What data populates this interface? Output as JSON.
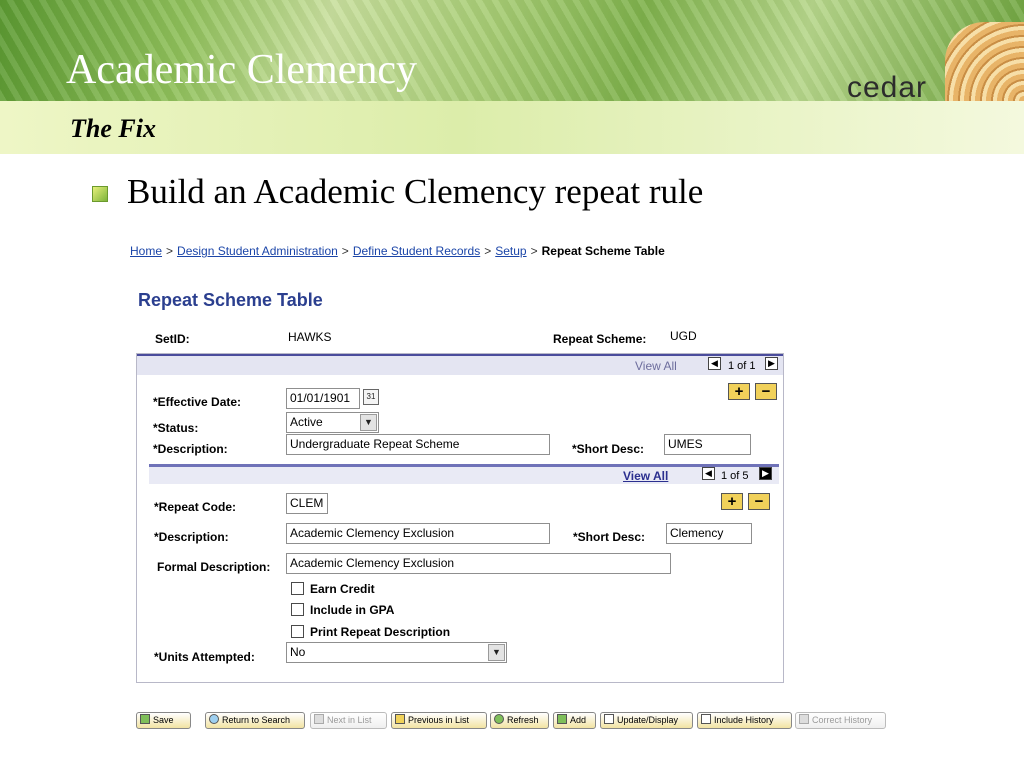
{
  "slide": {
    "title": "Academic Clemency",
    "subtitle": "The Fix",
    "logo_text": "cedar",
    "bullet": "Build an Academic Clemency repeat rule"
  },
  "breadcrumb": {
    "items": [
      "Home",
      "Design Student Administration",
      "Define Student Records",
      "Setup"
    ],
    "current": "Repeat Scheme Table",
    "sep": ">"
  },
  "page": {
    "title": "Repeat Scheme Table",
    "setid_label": "SetID:",
    "setid_value": "HAWKS",
    "scheme_label": "Repeat Scheme:",
    "scheme_value": "UGD"
  },
  "outer_grid": {
    "view_all": "View All",
    "pager": "1 of 1",
    "effective_date_label": "*Effective Date:",
    "effective_date": "01/01/1901",
    "status_label": "*Status:",
    "status": "Active",
    "description_label": "*Description:",
    "description": "Undergraduate Repeat Scheme",
    "short_desc_label": "*Short Desc:",
    "short_desc": "UMES"
  },
  "inner_grid": {
    "view_all": "View All",
    "pager": "1 of 5",
    "repeat_code_label": "*Repeat Code:",
    "repeat_code": "CLEM",
    "description_label": "*Description:",
    "description": "Academic Clemency Exclusion",
    "short_desc_label": "*Short Desc:",
    "short_desc": "Clemency",
    "formal_desc_label": "Formal Description:",
    "formal_desc": "Academic Clemency Exclusion",
    "checkboxes": [
      "Earn Credit",
      "Include in GPA",
      "Print Repeat Description"
    ],
    "units_label": "*Units Attempted:",
    "units": "No"
  },
  "toolbar": {
    "save": "Save",
    "return_to_search": "Return to Search",
    "next_in_list": "Next in List",
    "previous_in_list": "Previous in List",
    "refresh": "Refresh",
    "add": "Add",
    "update_display": "Update/Display",
    "include_history": "Include History",
    "correct_history": "Correct History"
  },
  "icons": {
    "bullet": "square-bullet-icon",
    "calendar": "calendar-icon",
    "prev": "arrow-left-icon",
    "next": "arrow-right-icon",
    "add_row": "plus-icon",
    "delete_row": "minus-icon",
    "dropdown": "chevron-down-icon"
  }
}
